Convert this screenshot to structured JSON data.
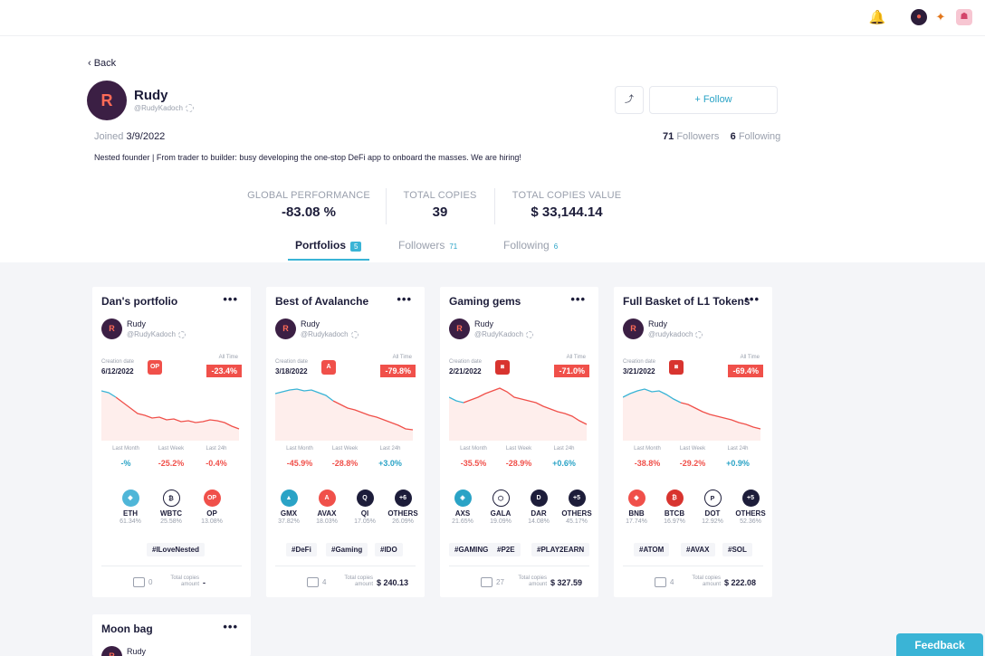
{
  "topbar": {
    "bell_icon": "bell-icon",
    "avatar_icon": "user-avatar-icon",
    "wallet_icon": "metamask-fox-icon",
    "network_icon": "network-icon"
  },
  "profile": {
    "back_label": "‹ Back",
    "name": "Rudy",
    "handle": "@RudyKadoch",
    "joined_label": "Joined",
    "joined_date": "3/9/2022",
    "bio": "Nested founder | From trader to builder: busy developing the one-stop DeFi app to onboard the masses. We are hiring!",
    "share_icon": "share-icon",
    "follow_label": "+ Follow",
    "followers_count": "71",
    "followers_label": "Followers",
    "following_count": "6",
    "following_label": "Following"
  },
  "stats": [
    {
      "label": "GLOBAL PERFORMANCE",
      "value": "-83.08 %"
    },
    {
      "label": "TOTAL COPIES",
      "value": "39"
    },
    {
      "label": "TOTAL COPIES VALUE",
      "value": "$ 33,144.14"
    }
  ],
  "tabs": [
    {
      "label": "Portfolios",
      "count": "5"
    },
    {
      "label": "Followers",
      "count": "71"
    },
    {
      "label": "Following",
      "count": "6"
    }
  ],
  "card_labels": {
    "creation_date": "Creation date",
    "all_time": "All Time",
    "last_month": "Last Month",
    "last_week": "Last Week",
    "last_24h": "Last 24h",
    "total_copies_amount": "Total copies amount"
  },
  "cards": [
    {
      "title": "Dan's portfolio",
      "owner": "Rudy",
      "handle": "@RudyKadoch",
      "creation_date": "6/12/2022",
      "chain": "OP",
      "chain_color": "#f0504a",
      "all_time": "-23.4%",
      "last_month": "-%",
      "last_week": "-25.2%",
      "last_24h": "-0.4%",
      "tokens": [
        {
          "symbol": "ETH",
          "pct": "61.34%",
          "color": "#4fb6d8",
          "icon": "ethereum-icon",
          "glyph": "◆"
        },
        {
          "symbol": "WBTC",
          "pct": "25.58%",
          "color": "#ffffff",
          "icon": "wbtc-icon",
          "glyph": "₿"
        },
        {
          "symbol": "OP",
          "pct": "13.08%",
          "color": "#f0504a",
          "icon": "optimism-icon",
          "glyph": "OP"
        }
      ],
      "tags": [
        "#ILoveNested"
      ],
      "copies": "0",
      "copies_value": "-",
      "chart_pts": [
        [
          0,
          5
        ],
        [
          8,
          7
        ],
        [
          16,
          12
        ],
        [
          24,
          18
        ],
        [
          32,
          24
        ],
        [
          40,
          30
        ],
        [
          48,
          32
        ],
        [
          56,
          35
        ],
        [
          64,
          34
        ],
        [
          72,
          37
        ],
        [
          80,
          36
        ],
        [
          88,
          39
        ],
        [
          96,
          38
        ],
        [
          104,
          40
        ],
        [
          112,
          39
        ],
        [
          120,
          37
        ],
        [
          128,
          38
        ],
        [
          136,
          40
        ],
        [
          144,
          44
        ],
        [
          152,
          47
        ]
      ]
    },
    {
      "title": "Best of Avalanche",
      "owner": "Rudy",
      "handle": "@Rudykadoch",
      "creation_date": "3/18/2022",
      "chain": "A",
      "chain_color": "#f0504a",
      "all_time": "-79.8%",
      "last_month": "-45.9%",
      "last_week": "-28.8%",
      "last_24h": "+3.0%",
      "tokens": [
        {
          "symbol": "GMX",
          "pct": "37.82%",
          "color": "#2aa3c6",
          "icon": "gmx-icon",
          "glyph": "▲"
        },
        {
          "symbol": "AVAX",
          "pct": "18.03%",
          "color": "#f0504a",
          "icon": "avax-icon",
          "glyph": "A"
        },
        {
          "symbol": "QI",
          "pct": "17.05%",
          "color": "#1d1d3a",
          "icon": "qi-icon",
          "glyph": "Q"
        },
        {
          "symbol": "OTHERS",
          "pct": "26.09%",
          "color": "#1d1d3a",
          "icon": "others-icon",
          "glyph": "+6"
        }
      ],
      "tags": [
        "#DeFi",
        "#Gaming",
        "#IDO"
      ],
      "copies": "4",
      "copies_value": "$ 240.13",
      "chart_pts": [
        [
          0,
          8
        ],
        [
          8,
          6
        ],
        [
          16,
          4
        ],
        [
          24,
          3
        ],
        [
          32,
          5
        ],
        [
          40,
          4
        ],
        [
          48,
          7
        ],
        [
          56,
          10
        ],
        [
          64,
          16
        ],
        [
          72,
          20
        ],
        [
          80,
          24
        ],
        [
          88,
          26
        ],
        [
          96,
          29
        ],
        [
          104,
          32
        ],
        [
          112,
          34
        ],
        [
          120,
          37
        ],
        [
          128,
          40
        ],
        [
          136,
          43
        ],
        [
          144,
          47
        ],
        [
          152,
          48
        ]
      ]
    },
    {
      "title": "Gaming gems",
      "owner": "Rudy",
      "handle": "@RudyKadoch",
      "creation_date": "2/21/2022",
      "chain": "⧈",
      "chain_color": "#d8342f",
      "all_time": "-71.0%",
      "last_month": "-35.5%",
      "last_week": "-28.9%",
      "last_24h": "+0.6%",
      "tokens": [
        {
          "symbol": "AXS",
          "pct": "21.65%",
          "color": "#2aa3c6",
          "icon": "axs-icon",
          "glyph": "◈"
        },
        {
          "symbol": "GALA",
          "pct": "19.09%",
          "color": "#ffffff",
          "icon": "gala-icon",
          "glyph": "⬡"
        },
        {
          "symbol": "DAR",
          "pct": "14.08%",
          "color": "#1d1d3a",
          "icon": "dar-icon",
          "glyph": "D"
        },
        {
          "symbol": "OTHERS",
          "pct": "45.17%",
          "color": "#1d1d3a",
          "icon": "others-icon",
          "glyph": "+5"
        }
      ],
      "tags": [
        "#GAMING",
        "#P2E",
        "#PLAY2EARN"
      ],
      "copies": "27",
      "copies_value": "$ 327.59",
      "chart_pts": [
        [
          0,
          12
        ],
        [
          8,
          16
        ],
        [
          16,
          18
        ],
        [
          24,
          15
        ],
        [
          32,
          12
        ],
        [
          40,
          8
        ],
        [
          48,
          5
        ],
        [
          56,
          2
        ],
        [
          64,
          6
        ],
        [
          72,
          12
        ],
        [
          80,
          14
        ],
        [
          88,
          16
        ],
        [
          96,
          18
        ],
        [
          104,
          22
        ],
        [
          112,
          25
        ],
        [
          120,
          28
        ],
        [
          128,
          30
        ],
        [
          136,
          33
        ],
        [
          144,
          38
        ],
        [
          152,
          42
        ]
      ]
    },
    {
      "title": "Full Basket of L1 Tokens",
      "owner": "Rudy",
      "handle": "@rudykadoch",
      "creation_date": "3/21/2022",
      "chain": "⧈",
      "chain_color": "#d8342f",
      "all_time": "-69.4%",
      "last_month": "-38.8%",
      "last_week": "-29.2%",
      "last_24h": "+0.9%",
      "tokens": [
        {
          "symbol": "BNB",
          "pct": "17.74%",
          "color": "#f0504a",
          "icon": "bnb-icon",
          "glyph": "◆"
        },
        {
          "symbol": "BTCB",
          "pct": "16.97%",
          "color": "#d8342f",
          "icon": "btcb-icon",
          "glyph": "₿"
        },
        {
          "symbol": "DOT",
          "pct": "12.92%",
          "color": "#ffffff",
          "icon": "polkadot-icon",
          "glyph": "P"
        },
        {
          "symbol": "OTHERS",
          "pct": "52.36%",
          "color": "#1d1d3a",
          "icon": "others-icon",
          "glyph": "+5"
        }
      ],
      "tags": [
        "#ATOM",
        "#AVAX",
        "#SOL"
      ],
      "copies": "4",
      "copies_value": "$ 222.08",
      "chart_pts": [
        [
          0,
          12
        ],
        [
          8,
          8
        ],
        [
          16,
          5
        ],
        [
          24,
          3
        ],
        [
          32,
          6
        ],
        [
          40,
          5
        ],
        [
          48,
          9
        ],
        [
          56,
          14
        ],
        [
          64,
          18
        ],
        [
          72,
          20
        ],
        [
          80,
          24
        ],
        [
          88,
          28
        ],
        [
          96,
          31
        ],
        [
          104,
          33
        ],
        [
          112,
          35
        ],
        [
          120,
          37
        ],
        [
          128,
          40
        ],
        [
          136,
          42
        ],
        [
          144,
          45
        ],
        [
          152,
          47
        ]
      ]
    },
    {
      "title": "Moon bag",
      "owner": "Rudy"
    }
  ],
  "feedback_label": "Feedback"
}
